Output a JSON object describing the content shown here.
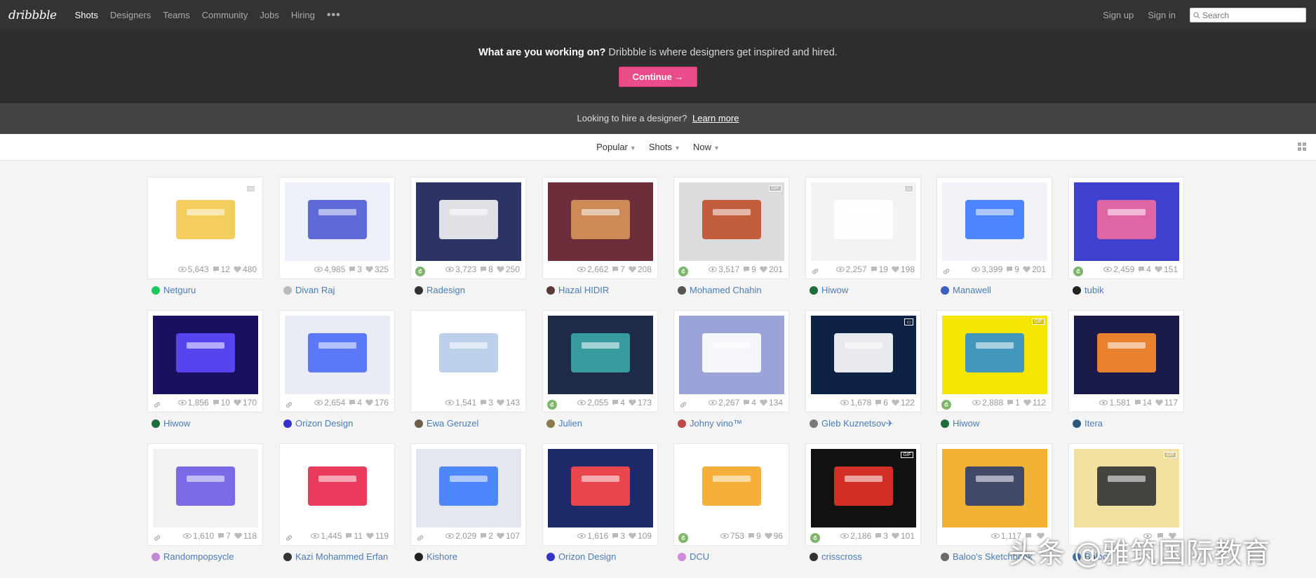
{
  "nav": {
    "logo": "dribbble",
    "links": [
      "Shots",
      "Designers",
      "Teams",
      "Community",
      "Jobs",
      "Hiring"
    ],
    "more": "•••",
    "signup": "Sign up",
    "signin": "Sign in",
    "search_placeholder": "Search"
  },
  "hero": {
    "question": "What are you working on?",
    "tagline": " Dribbble is where designers get inspired and hired.",
    "button": "Continue →"
  },
  "hire": {
    "text": "Looking to hire a designer?",
    "link": "Learn more"
  },
  "filters": {
    "sort": "Popular",
    "type": "Shots",
    "time": "Now"
  },
  "colors": {
    "accent": "#ea4c89",
    "link": "#4a7cb5",
    "nav_bg": "#333333",
    "hero_bg": "#2d2d2d"
  },
  "shots": [
    {
      "views": "5,643",
      "comments": "12",
      "likes": "480",
      "designer": "Netguru",
      "avatar": "#1ec85f",
      "left": "none",
      "thumb": "#ffffff",
      "accent": "#f2c94c",
      "badge": "video"
    },
    {
      "views": "4,985",
      "comments": "3",
      "likes": "325",
      "designer": "Divan Raj",
      "avatar": "#bbbbbb",
      "left": "none",
      "thumb": "#eef0fa",
      "accent": "#4f5bd5",
      "badge": ""
    },
    {
      "views": "3,723",
      "comments": "8",
      "likes": "250",
      "designer": "Radesign",
      "avatar": "#333333",
      "left": "rebound",
      "thumb": "#2c3466",
      "accent": "#f4f4f4",
      "badge": ""
    },
    {
      "views": "2,662",
      "comments": "7",
      "likes": "208",
      "designer": "Hazal HIDIR",
      "avatar": "#5a3a3a",
      "left": "none",
      "thumb": "#6b2e3a",
      "accent": "#d8935a",
      "badge": ""
    },
    {
      "views": "3,517",
      "comments": "9",
      "likes": "201",
      "designer": "Mohamed Chahin",
      "avatar": "#555555",
      "left": "rebound",
      "thumb": "#dcdcde",
      "accent": "#c0502a",
      "badge": "gif"
    },
    {
      "views": "2,257",
      "comments": "19",
      "likes": "198",
      "designer": "Hiwow",
      "avatar": "#1d6d3a",
      "left": "link",
      "thumb": "#f2f2f2",
      "accent": "#ffffff",
      "badge": "video"
    },
    {
      "views": "3,399",
      "comments": "9",
      "likes": "201",
      "designer": "Manawell",
      "avatar": "#3b5fc0",
      "left": "link",
      "thumb": "#f0f2f8",
      "accent": "#3a79ff",
      "badge": ""
    },
    {
      "views": "2,459",
      "comments": "4",
      "likes": "151",
      "designer": "tubik",
      "avatar": "#222222",
      "left": "rebound",
      "thumb": "#3f3fd0",
      "accent": "#f06aa0",
      "badge": ""
    },
    {
      "views": "1,856",
      "comments": "10",
      "likes": "170",
      "designer": "Hiwow",
      "avatar": "#1d6d3a",
      "left": "link",
      "thumb": "#1a1060",
      "accent": "#5d4bff",
      "badge": ""
    },
    {
      "views": "2,654",
      "comments": "4",
      "likes": "176",
      "designer": "Orizon Design",
      "avatar": "#3434c8",
      "left": "link",
      "thumb": "#e9ecf4",
      "accent": "#4a6cf7",
      "badge": ""
    },
    {
      "views": "1,541",
      "comments": "3",
      "likes": "143",
      "designer": "Ewa Geruzel",
      "avatar": "#6e5b4a",
      "left": "none",
      "thumb": "#ffffff",
      "accent": "#b5cbe8",
      "badge": ""
    },
    {
      "views": "2,055",
      "comments": "4",
      "likes": "173",
      "designer": "Julien",
      "avatar": "#8a7a4a",
      "left": "rebound",
      "thumb": "#1e2b48",
      "accent": "#3aa6a6",
      "badge": ""
    },
    {
      "views": "2,267",
      "comments": "4",
      "likes": "134",
      "designer": "Johny vino™",
      "avatar": "#c04848",
      "left": "link",
      "thumb": "#9aa4d8",
      "accent": "#ffffff",
      "badge": ""
    },
    {
      "views": "1,678",
      "comments": "6",
      "likes": "122",
      "designer": "Gleb Kuznetsov✈",
      "avatar": "#7a7a7a",
      "left": "none",
      "thumb": "#0e2246",
      "accent": "#ffffff",
      "badge": "video"
    },
    {
      "views": "2,888",
      "comments": "1",
      "likes": "112",
      "designer": "Hiwow",
      "avatar": "#1d6d3a",
      "left": "rebound",
      "thumb": "#f6e500",
      "accent": "#2e8fd0",
      "badge": "gif"
    },
    {
      "views": "1,581",
      "comments": "14",
      "likes": "117",
      "designer": "Itera",
      "avatar": "#2a5a7a",
      "left": "none",
      "thumb": "#1a1a4a",
      "accent": "#ff8c2a",
      "badge": ""
    },
    {
      "views": "1,610",
      "comments": "7",
      "likes": "118",
      "designer": "Randompopsycle",
      "avatar": "#c08ad8",
      "left": "link",
      "thumb": "#f2f2f2",
      "accent": "#6c5ce7",
      "badge": ""
    },
    {
      "views": "1,445",
      "comments": "11",
      "likes": "119",
      "designer": "Kazi Mohammed Erfan",
      "avatar": "#333333",
      "left": "link",
      "thumb": "#ffffff",
      "accent": "#e8264a",
      "badge": ""
    },
    {
      "views": "2,029",
      "comments": "2",
      "likes": "107",
      "designer": "Kishore",
      "avatar": "#222222",
      "left": "link",
      "thumb": "#e4e8ee",
      "accent": "#3d7bfd",
      "badge": ""
    },
    {
      "views": "1,616",
      "comments": "3",
      "likes": "109",
      "designer": "Orizon Design",
      "avatar": "#3434c8",
      "left": "none",
      "thumb": "#1e2a6a",
      "accent": "#ff4a4a",
      "badge": ""
    },
    {
      "views": "753",
      "comments": "9",
      "likes": "96",
      "designer": "DCU",
      "avatar": "#d18adb",
      "left": "rebound",
      "thumb": "#ffffff",
      "accent": "#f5a623",
      "badge": ""
    },
    {
      "views": "2,186",
      "comments": "3",
      "likes": "101",
      "designer": "crisscross",
      "avatar": "#333333",
      "left": "rebound",
      "thumb": "#111111",
      "accent": "#e8342a",
      "badge": "gif"
    },
    {
      "views": "1,117",
      "comments": "",
      "likes": "",
      "designer": "Baloo's Sketchbook",
      "avatar": "#6a6a6a",
      "left": "none",
      "thumb": "#f2b233",
      "accent": "#2f3c6e",
      "badge": ""
    },
    {
      "views": "",
      "comments": "",
      "likes": "",
      "designer": "Baloo",
      "avatar": "#4a7cb5",
      "left": "none",
      "thumb": "#f2e0a0",
      "accent": "#333333",
      "badge": "gif"
    }
  ],
  "watermark": "头条 @雅筑国际教育"
}
